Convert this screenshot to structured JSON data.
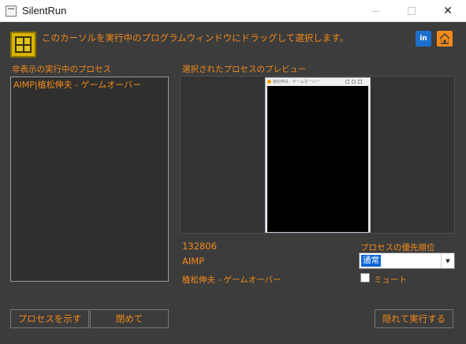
{
  "window": {
    "title": "SilentRun"
  },
  "header": {
    "instruction": "このカーソルを実行中のプログラムウィンドウにドラッグして選択します。",
    "twitter_icon_text": "in"
  },
  "hidden_processes": {
    "label": "非表示の実行中のプロセス",
    "items": [
      "AIMP|植松伸夫 - ゲームオーバー"
    ]
  },
  "preview": {
    "label": "選択されたプロセスのプレビュー",
    "thumb_title": "植松伸夫 - ゲームオーバー"
  },
  "selected_process": {
    "pid": "132806",
    "name": "AIMP",
    "window_title": "植松伸夫 - ゲームオーバー"
  },
  "priority": {
    "label": "プロセスの優先順位",
    "value": "通常"
  },
  "mute": {
    "label": "ミュート",
    "checked": false
  },
  "buttons": {
    "show_process": "プロセスを示す",
    "close": "閉めて",
    "run_hidden": "隠れて実行する"
  },
  "colors": {
    "accent": "#f28a1a",
    "background": "#3c3c3c",
    "selection": "#0a64d6"
  }
}
